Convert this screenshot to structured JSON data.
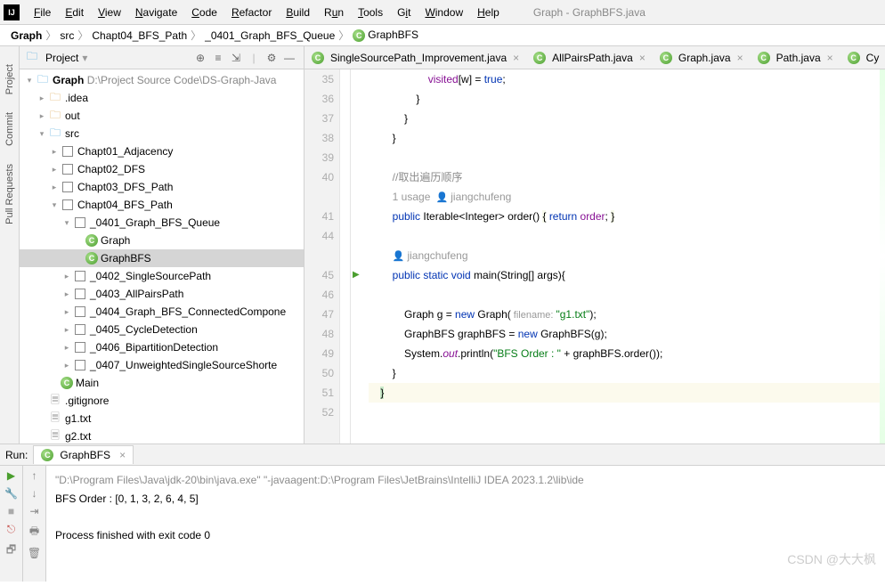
{
  "window": {
    "title": "Graph - GraphBFS.java"
  },
  "menu": [
    "File",
    "Edit",
    "View",
    "Navigate",
    "Code",
    "Refactor",
    "Build",
    "Run",
    "Tools",
    "Git",
    "Window",
    "Help"
  ],
  "crumbs": {
    "items": [
      "Graph",
      "src",
      "Chapt04_BFS_Path",
      "_0401_Graph_BFS_Queue"
    ],
    "file": "GraphBFS"
  },
  "sidebar": {
    "tabs": [
      "Project",
      "Commit",
      "Pull Requests"
    ]
  },
  "project": {
    "label": "Project",
    "root": {
      "name": "Graph",
      "hint": "D:\\Project Source Code\\DS-Graph-Java"
    },
    "idea": ".idea",
    "out": "out",
    "src": "src",
    "ch": [
      "Chapt01_Adjacency",
      "Chapt02_DFS",
      "Chapt03_DFS_Path",
      "Chapt04_BFS_Path"
    ],
    "p0401": "_0401_Graph_BFS_Queue",
    "cls": [
      "Graph",
      "GraphBFS"
    ],
    "sibs": [
      "_0402_SingleSourcePath",
      "_0403_AllPairsPath",
      "_0404_Graph_BFS_ConnectedCompone",
      "_0405_CycleDetection",
      "_0406_BipartitionDetection",
      "_0407_UnweightedSingleSourceShorte"
    ],
    "main": "Main",
    "gi": ".gitignore",
    "g1": "g1.txt",
    "g2": "g2.txt"
  },
  "tabs": [
    "SingleSourcePath_Improvement.java",
    "AllPairsPath.java",
    "Graph.java",
    "Path.java",
    "Cy"
  ],
  "toolbtn": {
    "target": "⊕",
    "select": "≡",
    "expand": "⇲",
    "gear": "⚙",
    "hide": "—"
  },
  "editor": {
    "lines": [
      35,
      36,
      37,
      38,
      39,
      40,
      41,
      44,
      45,
      46,
      47,
      48,
      49,
      50,
      51,
      52
    ],
    "hint1": "1 usage",
    "author": "jiangchufeng",
    "comment": "//取出遍历顺序"
  },
  "run": {
    "label": "Run:",
    "tab": "GraphBFS",
    "cmd": "\"D:\\Program Files\\Java\\jdk-20\\bin\\java.exe\" \"-javaagent:D:\\Program Files\\JetBrains\\IntelliJ IDEA 2023.1.2\\lib\\ide",
    "out1": "BFS Order : [0, 1, 3, 2, 6, 4, 5]",
    "out2": "Process finished with exit code 0"
  },
  "watermark": "CSDN @大大枫"
}
